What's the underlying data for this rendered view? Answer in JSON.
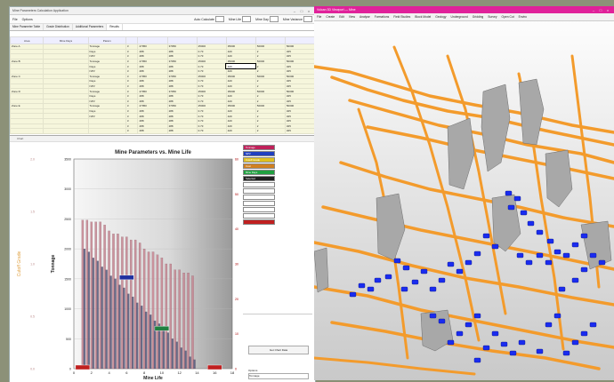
{
  "left_window": {
    "title": "Mine Parameters Calculation Application",
    "toolbar": {
      "file": "File",
      "options": "Options",
      "auto_calculate": "Auto Calculate",
      "mine_life": "Mine Life",
      "mine_life_value": "",
      "mine_day": "Mine Day",
      "mine_day_value": "",
      "mine_variance": "Mine Variance",
      "mine_variance_value": ""
    },
    "tabs": [
      "Mine Parameter Table",
      "Grade Distribution",
      "Additional Parameters",
      "Results"
    ],
    "active_tab": 3,
    "grid": {
      "headers": [
        "Area",
        "Mine Days",
        "Param",
        "",
        "",
        "",
        "",
        "",
        "",
        ""
      ],
      "rows": [
        [
          "Zone A",
          "",
          "Tonnage",
          "3",
          "27950",
          "37950",
          "25000",
          "35000",
          "50000",
          "50000"
        ],
        [
          "",
          "",
          "Days",
          "3",
          "288",
          "288",
          "0.73",
          "420",
          "2",
          "325"
        ],
        [
          "",
          "",
          "NPV",
          "3",
          "288",
          "288",
          "0.73",
          "420",
          "2",
          "325"
        ],
        [
          "Zone B",
          "",
          "Tonnage",
          "3",
          "27950",
          "37950",
          "25000",
          "35000",
          "50000",
          "50000"
        ],
        [
          "",
          "",
          "Days",
          "3",
          "288",
          "288",
          "0.73",
          "420",
          "2",
          "325"
        ],
        [
          "",
          "",
          "NPV",
          "3",
          "288",
          "288",
          "0.73",
          "420",
          "2",
          "325"
        ],
        [
          "Zone C",
          "",
          "Tonnage",
          "3",
          "27950",
          "37950",
          "25000",
          "35000",
          "50000",
          "50000"
        ],
        [
          "",
          "",
          "Days",
          "3",
          "288",
          "288",
          "0.73",
          "420",
          "2",
          "325"
        ],
        [
          "",
          "",
          "NPV",
          "3",
          "288",
          "288",
          "0.73",
          "420",
          "2",
          "325"
        ],
        [
          "Zone D",
          "",
          "Tonnage",
          "3",
          "27950",
          "37950",
          "25000",
          "35000",
          "50000",
          "50000"
        ],
        [
          "",
          "",
          "Days",
          "3",
          "288",
          "288",
          "0.73",
          "420",
          "2",
          "325"
        ],
        [
          "",
          "",
          "NPV",
          "3",
          "288",
          "288",
          "0.73",
          "420",
          "2",
          "325"
        ],
        [
          "Zone E",
          "",
          "Tonnage",
          "3",
          "27950",
          "37950",
          "25000",
          "35000",
          "50000",
          "50000"
        ],
        [
          "",
          "",
          "Days",
          "3",
          "288",
          "288",
          "0.73",
          "420",
          "2",
          "325"
        ],
        [
          "",
          "",
          "NPV",
          "3",
          "288",
          "288",
          "0.73",
          "420",
          "2",
          "325"
        ],
        [
          "",
          "",
          "",
          "3",
          "288",
          "288",
          "0.73",
          "420",
          "2",
          "325"
        ],
        [
          "",
          "",
          "",
          "3",
          "288",
          "288",
          "0.73",
          "420",
          "2",
          "325"
        ],
        [
          "",
          "",
          "",
          "3",
          "288",
          "288",
          "0.73",
          "420",
          "2",
          "325"
        ],
        [
          "",
          "",
          "",
          "3",
          "288",
          "288",
          "0.73",
          "420",
          "2",
          "325"
        ],
        [
          "",
          "",
          "",
          "3",
          "288",
          "288",
          "0.73",
          "420",
          "2",
          "325"
        ],
        [
          "",
          "",
          "",
          "3",
          "288",
          "288",
          "0.73",
          "420",
          "2",
          "325"
        ]
      ],
      "selected_cell": [
        4,
        7
      ]
    },
    "chart_panel_title": "Chart",
    "legend": [
      {
        "label": "Tonnage",
        "color": "#c0205a"
      },
      {
        "label": "NPV",
        "color": "#2040c0"
      },
      {
        "label": "Cutoff Grade",
        "color": "#e0c020"
      },
      {
        "label": "Cost",
        "color": "#d08020"
      },
      {
        "label": "Mine Days",
        "color": "#20a040"
      },
      {
        "label": "Selected",
        "color": "#202020"
      },
      {
        "label": "",
        "color": "#ffffff"
      },
      {
        "label": "",
        "color": "#ffffff"
      },
      {
        "label": "",
        "color": "#ffffff"
      },
      {
        "label": "",
        "color": "#ffffff"
      },
      {
        "label": "",
        "color": "#ffffff"
      },
      {
        "label": "",
        "color": "#ffffff"
      },
      {
        "label": "",
        "color": "#c02020"
      }
    ],
    "side_button": "Get Chart Data",
    "side_label": "Options",
    "side_select": "Tonnage"
  },
  "chart_data": {
    "type": "bar",
    "title": "Mine Parameters vs. Mine Life",
    "xlabel": "Mine Life",
    "ylabel_left": "Tonnage",
    "ylabel_far_left": "Cutoff Grade",
    "ylabel_right": "NPV",
    "x_ticks": [
      "0",
      "2",
      "4",
      "6",
      "8",
      "10",
      "12",
      "14",
      "16",
      "18"
    ],
    "y_ticks_left": [
      "0",
      "500",
      "1000",
      "1500",
      "2000",
      "2500",
      "3000",
      "3500"
    ],
    "y_ticks_right": [
      "0",
      "10",
      "20",
      "30",
      "40",
      "50",
      "60"
    ],
    "y_ticks_far_left": [
      "0.0",
      "0.5",
      "1.0",
      "1.5",
      "2.0"
    ],
    "xlim": [
      0,
      18
    ],
    "ylim": [
      0,
      3500
    ],
    "series": [
      {
        "name": "Tonnage",
        "color": "#c78a95",
        "x": [
          1,
          1.5,
          2,
          2.5,
          3,
          3.5,
          4,
          4.5,
          5,
          5.5,
          6,
          6.5,
          7,
          7.5,
          8,
          8.5,
          9,
          9.5,
          10,
          10.5,
          11,
          11.5,
          12,
          12.5,
          13,
          13.5
        ],
        "values": [
          2480,
          2480,
          2450,
          2450,
          2450,
          2400,
          2300,
          2250,
          2250,
          2200,
          2200,
          2150,
          2150,
          2100,
          2000,
          1950,
          1950,
          1900,
          1850,
          1750,
          1750,
          1650,
          1650,
          1600,
          1600,
          1550
        ]
      },
      {
        "name": "NPV",
        "color": "#5a5f80",
        "x": [
          1.2,
          1.7,
          2.2,
          2.7,
          3.2,
          3.7,
          4.2,
          4.7,
          5.2,
          5.7,
          6.2,
          6.7,
          7.2,
          7.7,
          8.2,
          8.7,
          9.2,
          9.7,
          10.2,
          10.7,
          11.2,
          11.7,
          12.2,
          12.7,
          13.2,
          13.7
        ],
        "values": [
          2000,
          1950,
          1850,
          1800,
          1700,
          1650,
          1550,
          1500,
          1400,
          1350,
          1250,
          1200,
          1100,
          1050,
          950,
          900,
          800,
          750,
          650,
          600,
          500,
          450,
          350,
          300,
          200,
          150
        ]
      }
    ],
    "annotations": [
      {
        "text": "",
        "x": 6,
        "y": 1500,
        "color": "#2030a0"
      },
      {
        "text": "",
        "x": 10,
        "y": 650,
        "color": "#208040"
      },
      {
        "text": "",
        "x": 1,
        "y": 0,
        "color": "#c02020"
      },
      {
        "text": "",
        "x": 16,
        "y": 0,
        "color": "#c02020"
      }
    ]
  },
  "right_window": {
    "title": "Vulcan 3D Viewport — Mine",
    "menu": [
      "File",
      "Create",
      "Edit",
      "View",
      "Analyse",
      "Formations",
      "Field Studies",
      "Block Model",
      "Geology",
      "Underground",
      "Gridding",
      "Survey",
      "Open Cut",
      "Enviro"
    ],
    "colors": {
      "tunnels": "#f39b2c",
      "stopes": "#a8a8a8",
      "blocks": "#1a2cf0",
      "background": "#e8e8e8"
    }
  }
}
